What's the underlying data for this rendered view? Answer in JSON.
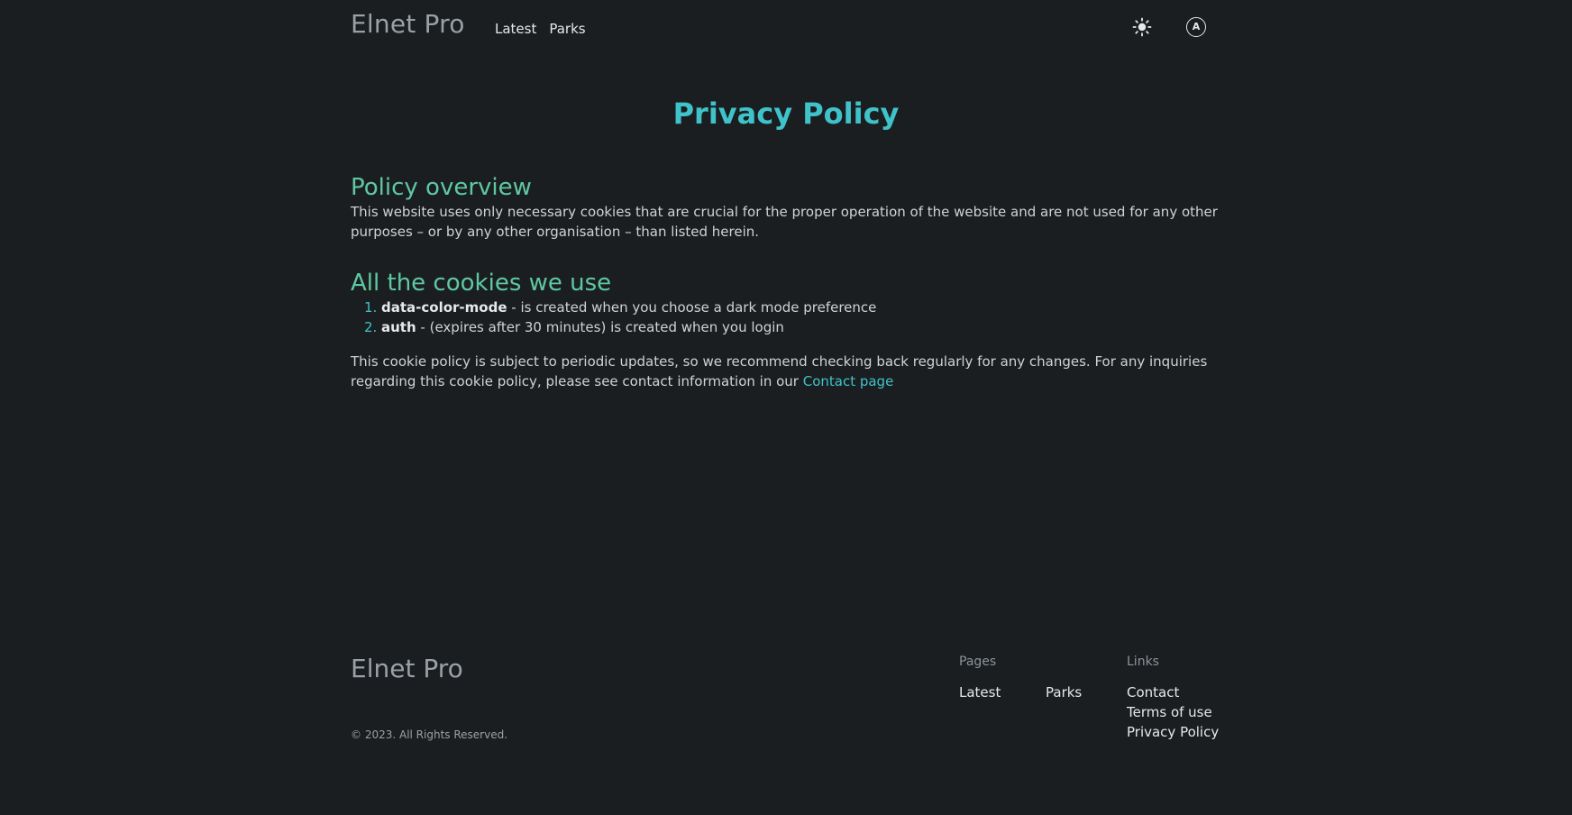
{
  "header": {
    "brand": "Elnet Pro",
    "nav": [
      {
        "label": "Latest"
      },
      {
        "label": "Parks"
      }
    ],
    "theme_toggle_icon": "sun-icon",
    "account_icon": "account-icon",
    "account_letter": "A"
  },
  "main": {
    "title": "Privacy Policy",
    "overview": {
      "heading": "Policy overview",
      "text": "This website uses only necessary cookies that are crucial for the proper operation of the website and are not used for any other purposes – or by any other organisation – than listed herein."
    },
    "cookies": {
      "heading": "All the cookies we use",
      "items": [
        {
          "number": "1.",
          "name": "data-color-mode",
          "description": " - is created when you choose a dark mode preference"
        },
        {
          "number": "2.",
          "name": "auth",
          "description": " - (expires after 30 minutes) is created when you login"
        }
      ]
    },
    "closing": {
      "text": "This cookie policy is subject to periodic updates, so we recommend checking back regularly for any changes. For any inquiries regarding this cookie policy, please see contact information in our ",
      "link_label": "Contact page"
    }
  },
  "footer": {
    "brand": "Elnet Pro",
    "copyright": "© 2023. All Rights Reserved.",
    "pages": {
      "title": "Pages",
      "links": [
        "Latest",
        "Parks"
      ]
    },
    "links": {
      "title": "Links",
      "links": [
        "Contact",
        "Terms of use",
        "Privacy Policy"
      ]
    }
  },
  "colors": {
    "background": "#1b1e20",
    "accent": "#3fc2c9",
    "heading_green": "#5ec8a2",
    "muted": "#9aa0a6"
  }
}
